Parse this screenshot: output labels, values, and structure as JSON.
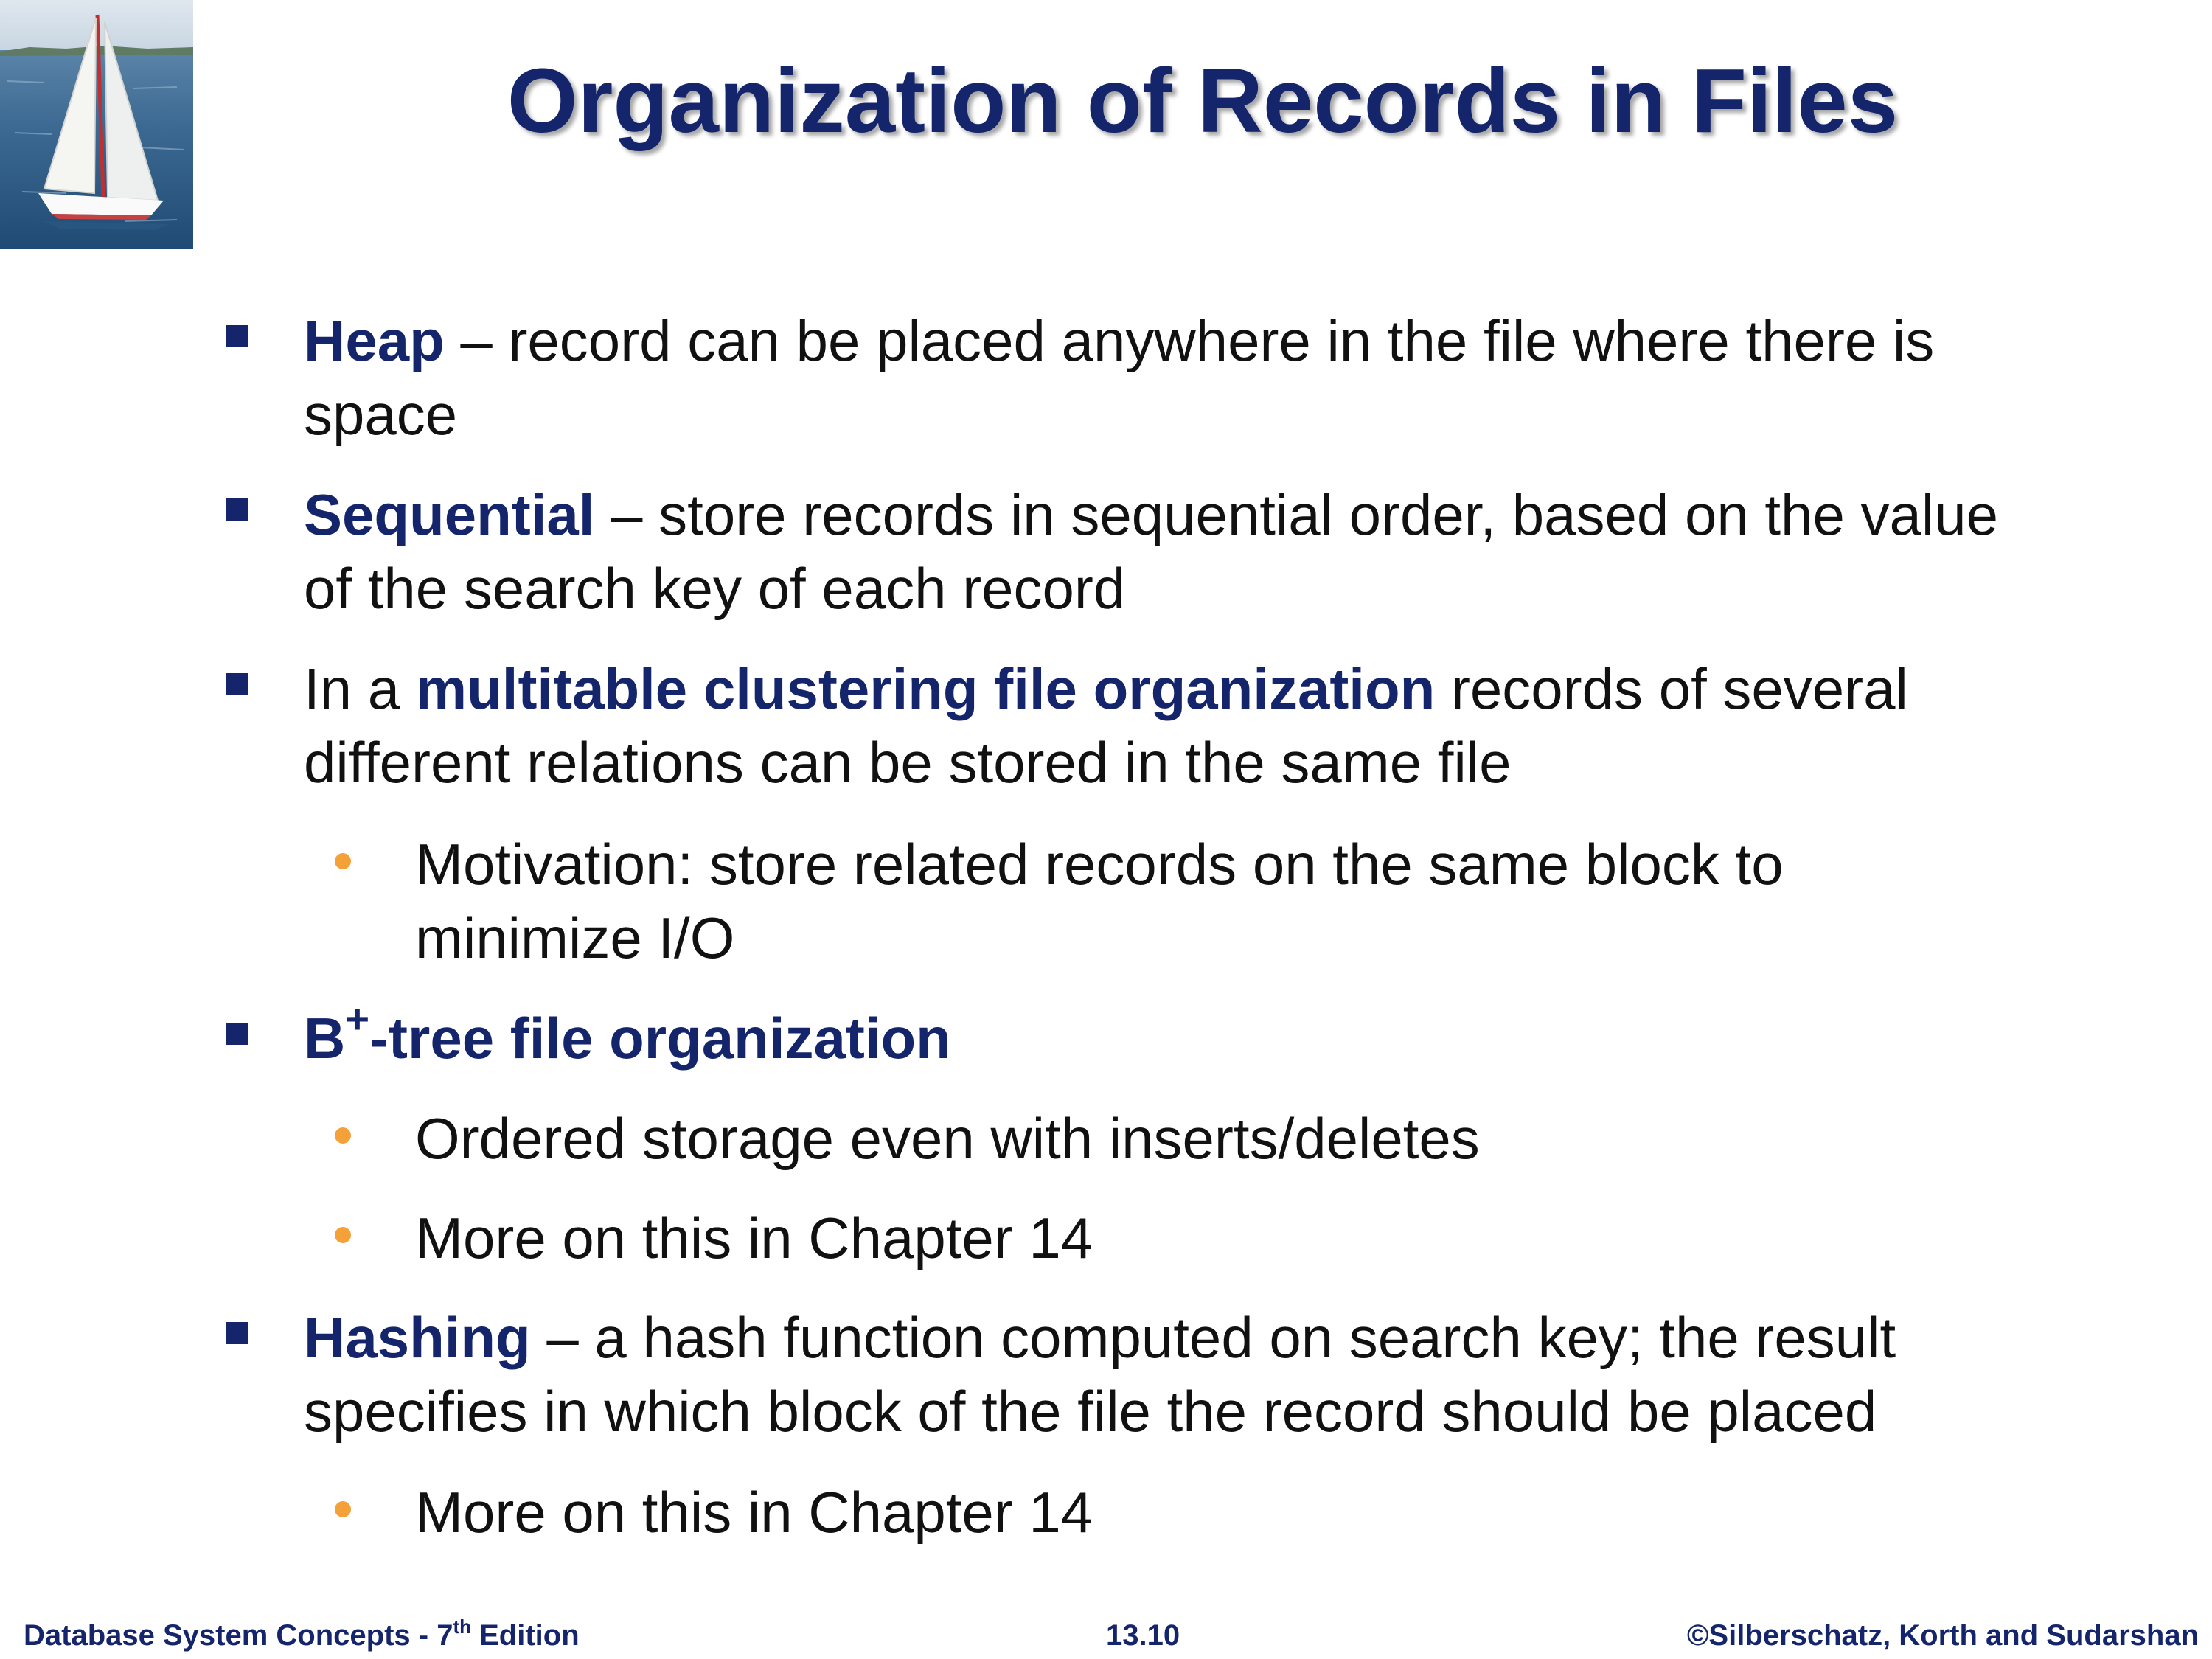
{
  "slide": {
    "title": "Organization of Records in Files"
  },
  "items": [
    {
      "keyword": "Heap",
      "line1": " – record can be placed anywhere in the file where there is",
      "line2": "space"
    },
    {
      "keyword": "Sequential",
      "line1": " – store records in sequential order, based on the value",
      "line2": "of the search key of each record"
    },
    {
      "prefix": "In a ",
      "keyword": "multitable clustering file organization",
      "line1": " records of several",
      "line2": "different relations can be stored in the same file",
      "sub": [
        {
          "line1": "Motivation: store related records on the same block to",
          "line2": "minimize I/O"
        }
      ]
    },
    {
      "keyword_base": "B",
      "keyword_sup": "+",
      "keyword_rest": "-tree file organization",
      "sub": [
        {
          "text": "Ordered storage even with inserts/deletes"
        },
        {
          "text": "More on this in Chapter 14"
        }
      ]
    },
    {
      "keyword": "Hashing",
      "line1": " – a hash function computed on search key; the result",
      "line2": "specifies in which block of the file the record should be placed",
      "sub": [
        {
          "text": "More on this in Chapter 14"
        }
      ]
    }
  ],
  "footer": {
    "left_base": "Database System Concepts - 7",
    "left_sup": "th",
    "left_rest": " Edition",
    "center": "13.10",
    "right": "©Silberschatz, Korth and Sudarshan"
  },
  "colors": {
    "title": "#14256b",
    "keyword": "#14256b",
    "square_bullet": "#14256b",
    "round_bullet": "#f4a13a",
    "text": "#111111"
  },
  "icons": {
    "logo": "sailboat-image",
    "level1_bullet": "square-bullet-icon",
    "level2_bullet": "dot-bullet-icon"
  }
}
